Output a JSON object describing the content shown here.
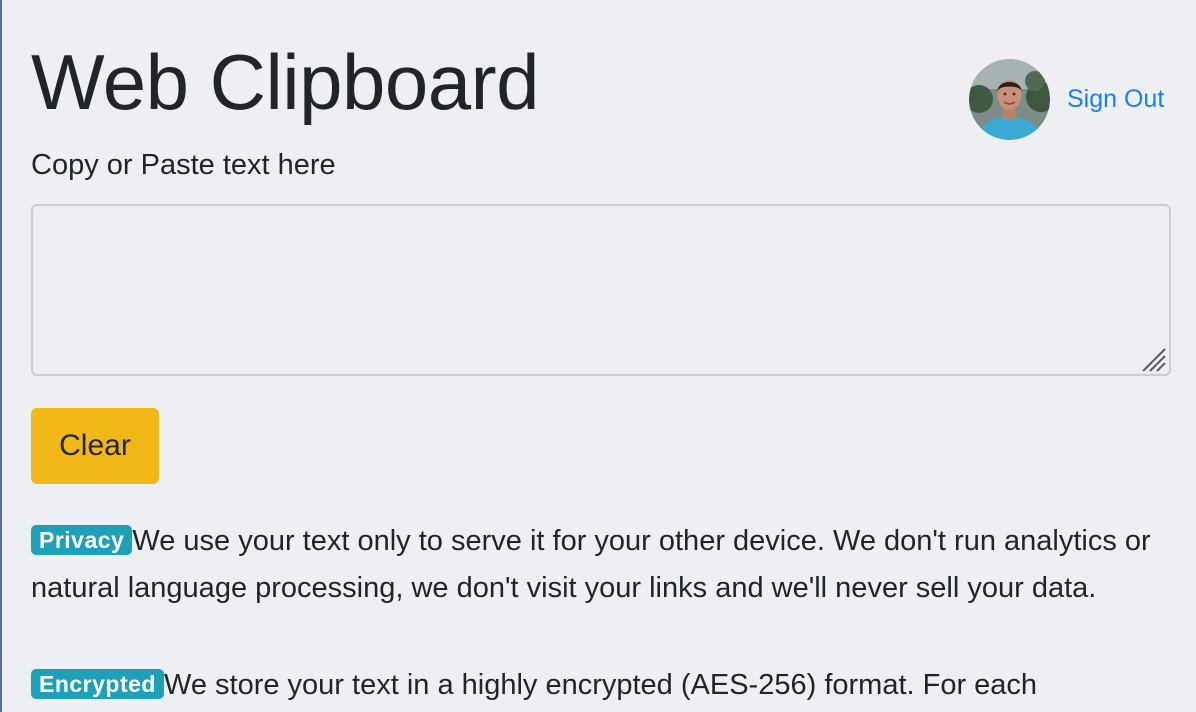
{
  "header": {
    "title": "Web Clipboard",
    "sign_out_label": "Sign Out",
    "avatar_icon": "user-avatar-icon"
  },
  "clipboard": {
    "label": "Copy or Paste text here",
    "value": "",
    "placeholder": ""
  },
  "actions": {
    "clear_label": "Clear"
  },
  "info": [
    {
      "badge": "Privacy",
      "text": "We use your text only to serve it for your other device. We don't run analytics or natural language processing, we don't visit your links and we'll never sell your data."
    },
    {
      "badge": "Encrypted",
      "text": "We store your text in a highly encrypted (AES-256) format. For each"
    }
  ],
  "colors": {
    "page_background": "#edeff3",
    "link": "#1a7ff0",
    "clear_button": "#f0b918",
    "badge": "#1ea1b8"
  }
}
